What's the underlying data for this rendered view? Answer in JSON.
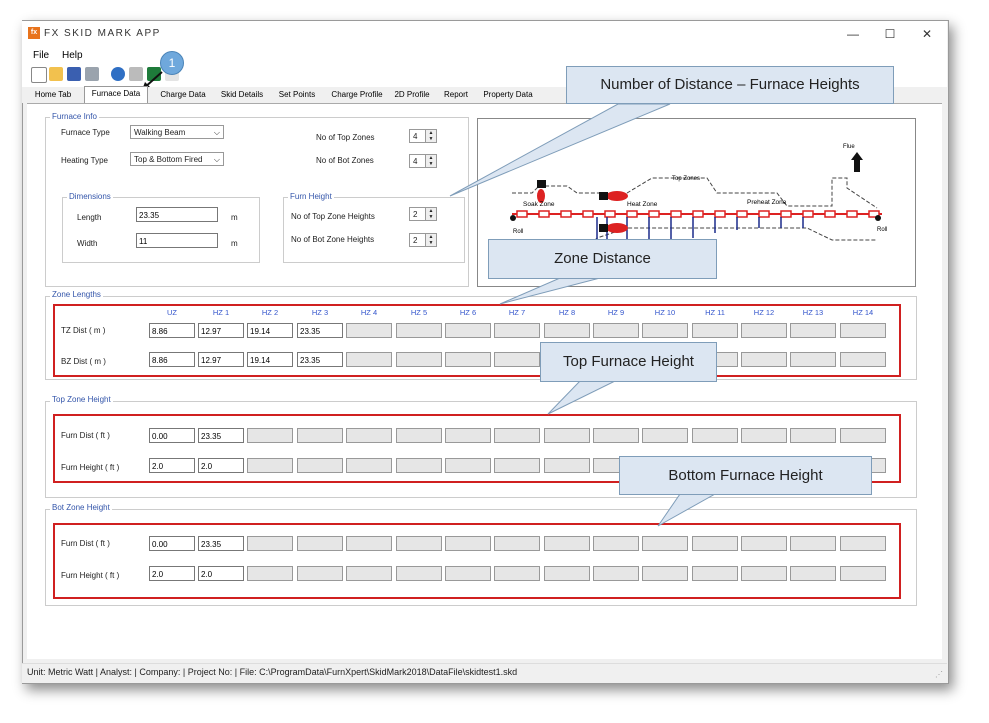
{
  "window": {
    "title": "FX SKID MARK APP",
    "icon_text": "fx",
    "minimize": "—",
    "maximize": "☐",
    "close": "✕"
  },
  "menu": {
    "file": "File",
    "help": "Help"
  },
  "toolbar": {
    "icons": [
      "new-icon",
      "open-icon",
      "save-icon",
      "print-icon",
      "help-icon",
      "report-icon",
      "excel-icon",
      "pdf-icon"
    ],
    "badge": "1"
  },
  "tabs": [
    "Home Tab",
    "Furnace Data",
    "Charge Data",
    "Skid Details",
    "Set Points",
    "Charge Profile",
    "2D Profile",
    "Report",
    "Property Data"
  ],
  "furnace_info": {
    "group": "Furnace Info",
    "type_label": "Furnace Type",
    "type_value": "Walking Beam",
    "heating_label": "Heating Type",
    "heating_value": "Top & Bottom Fired",
    "top_zones_label": "No of Top Zones",
    "top_zones_value": "4",
    "bot_zones_label": "No of Bot Zones",
    "bot_zones_value": "4",
    "dimensions_group": "Dimensions",
    "length_label": "Length",
    "length_value": "23.35",
    "length_unit": "m",
    "width_label": "Width",
    "width_value": "11",
    "width_unit": "m",
    "furn_height_group": "Furn Height",
    "top_zone_heights_label": "No of Top Zone  Heights",
    "top_zone_heights_value": "2",
    "bot_zone_heights_label": "No of Bot Zone Heights",
    "bot_zone_heights_value": "2"
  },
  "diagram": {
    "soak": "Soak Zone",
    "heat": "Heat Zone",
    "preheat": "Preheat Zone",
    "top_zones": "Top Zones",
    "flue": "Flue",
    "roll_left": "Roll",
    "roll_right": "Roll"
  },
  "zone_lengths": {
    "group": "Zone Lengths",
    "headers": [
      "UZ",
      "HZ 1",
      "HZ 2",
      "HZ 3",
      "HZ 4",
      "HZ 5",
      "HZ 6",
      "HZ 7",
      "HZ 8",
      "HZ 9",
      "HZ 10",
      "HZ 11",
      "HZ 12",
      "HZ 13",
      "HZ 14"
    ],
    "tz_label": "TZ Dist ( m )",
    "tz_values": [
      "8.86",
      "12.97",
      "19.14",
      "23.35"
    ],
    "bz_label": "BZ Dist ( m )",
    "bz_values": [
      "8.86",
      "12.97",
      "19.14",
      "23.35"
    ]
  },
  "top_zone_height": {
    "group": "Top Zone Height",
    "dist_label": "Furn Dist ( ft )",
    "dist_values": [
      "0.00",
      "23.35"
    ],
    "height_label": "Furn Height ( ft )",
    "height_values": [
      "2.0",
      "2.0"
    ]
  },
  "bot_zone_height": {
    "group": "Bot Zone Height",
    "dist_label": "Furn Dist ( ft )",
    "dist_values": [
      "0.00",
      "23.35"
    ],
    "height_label": "Furn Height ( ft )",
    "height_values": [
      "2.0",
      "2.0"
    ]
  },
  "callouts": {
    "distance_heights": "Number of Distance  – Furnace Heights",
    "zone_distance": "Zone Distance",
    "top_height": "Top Furnace Height",
    "bottom_height": "Bottom Furnace Height"
  },
  "status": "Unit: Metric Watt  | Analyst:   | Company:   | Project No:   | File: C:\\ProgramData\\FurnXpert\\SkidMark2018\\DataFile\\skidtest1.skd"
}
